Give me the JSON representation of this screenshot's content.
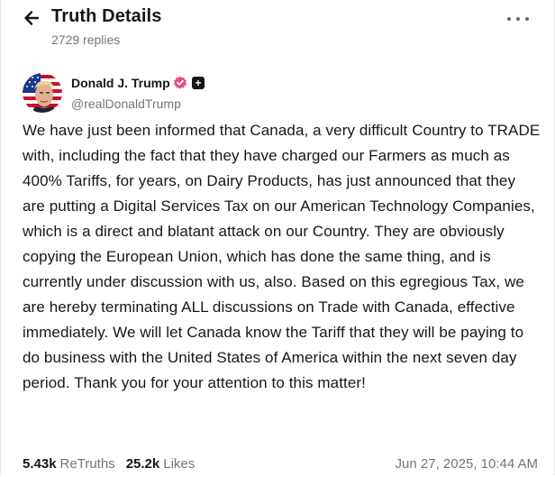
{
  "header": {
    "title": "Truth Details",
    "replies": "2729 replies"
  },
  "icons": {
    "back": "arrow-left-icon",
    "more": "more-horizontal-icon",
    "verified": "verified-badge-icon",
    "plus": "plus-square-icon"
  },
  "colors": {
    "verified_badge": "#ea4c89",
    "muted_text": "#71767b",
    "primary_text": "#14171a"
  },
  "post": {
    "author_name": "Donald J. Trump",
    "handle": "@realDonaldTrump",
    "plus_glyph": "+",
    "text": "We have just been informed that Canada, a very difficult Country to TRADE with, including the fact that they have charged our Farmers as much as 400% Tariffs, for years, on Dairy Products, has just announced that they are putting a Digital Services Tax on our American Technology Companies, which is a direct and blatant attack on our Country. They are obviously copying the European Union, which has done the same thing, and is currently under discussion with us, also. Based on this egregious Tax, we are hereby terminating ALL discussions on Trade with Canada, effective immediately. We will let Canada know the Tariff that they will be paying to do business with the United States of America within the next seven day period. Thank you for your attention to this matter!"
  },
  "stats": {
    "retruths_count": "5.43k",
    "retruths_label": "ReTruths",
    "likes_count": "25.2k",
    "likes_label": "Likes",
    "timestamp": "Jun 27, 2025, 10:44 AM"
  }
}
